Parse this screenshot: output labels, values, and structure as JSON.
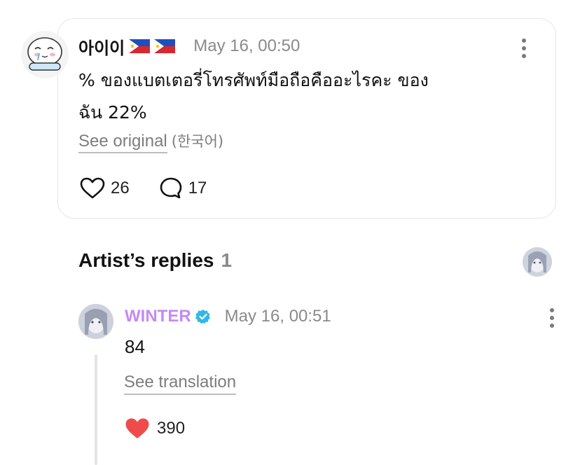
{
  "post": {
    "author": "아이이",
    "time": "May 16, 00:50",
    "text": "% ของแบตเตอรี่โทรศัพท์มือถือคืออะไรคะ ของ\nฉัน 22%",
    "see_original": "See original",
    "original_language": "(한국어)",
    "likes": "26",
    "comments": "17"
  },
  "section": {
    "title": "Artist’s replies",
    "count": "1"
  },
  "reply": {
    "author": "WINTER",
    "time": "May 16, 00:51",
    "text": "84",
    "see_translation": "See translation",
    "likes": "390"
  },
  "icons": {
    "like": "heart-outline-icon",
    "comment": "comment-bubble-icon",
    "liked": "heart-filled-icon",
    "verified": "verified-badge-icon",
    "more": "more-vertical-icon"
  },
  "colors": {
    "artist_name": "#c58af3",
    "verified": "#2fb8e8",
    "liked_heart": "#f04b4b"
  }
}
